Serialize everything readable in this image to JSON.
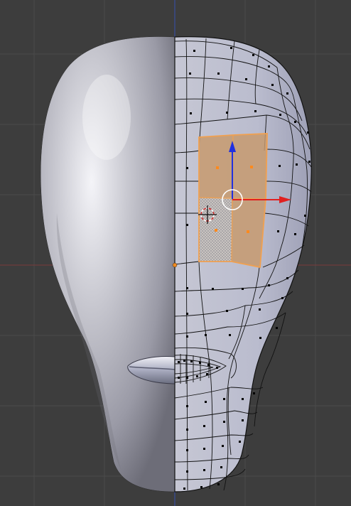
{
  "viewport": {
    "mode": "edit-mode-mirror-modifier",
    "background_color": "#3d3d3d",
    "grid_color": "#4a4a4a",
    "x_axis_color": "#7a3a3a",
    "y_axis_color": "#3a4a8a"
  },
  "mesh": {
    "solid_side": "left",
    "wireframe_side": "right",
    "surface_color": "#c9cad8",
    "edge_color": "#111111",
    "vertex_color": "#000000",
    "selection_color": "#f0a050",
    "selected_faces": 4
  },
  "gizmo": {
    "x_axis_color": "#e02020",
    "z_axis_color": "#2030e0",
    "center_ring_color": "#ffffff"
  },
  "cursor_3d": {
    "colors": [
      "#d03030",
      "#ffffff"
    ]
  }
}
